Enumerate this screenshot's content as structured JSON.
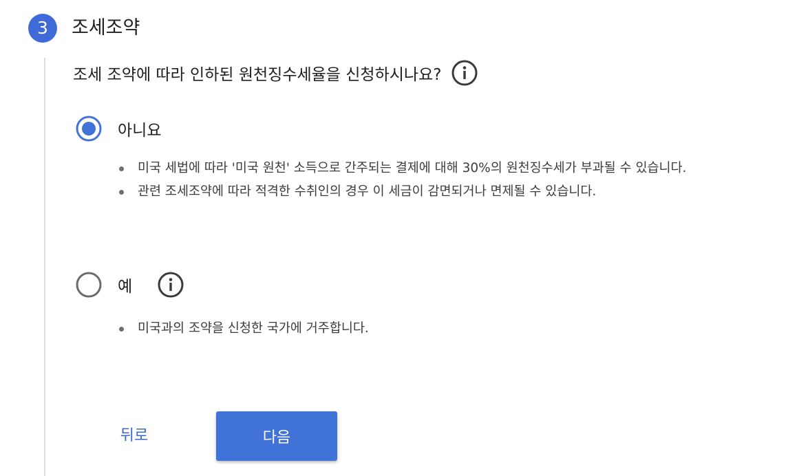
{
  "step": {
    "number": "3",
    "title": "조세조약"
  },
  "question": {
    "text": "조세 조약에 따라 인하된 원천징수세율을 신청하시나요?",
    "info_icon": "info-icon"
  },
  "options": [
    {
      "label": "아니요",
      "selected": true,
      "bullets": [
        "미국 세법에 따라 '미국 원천' 소득으로 간주되는 결제에 대해 30%의 원천징수세가 부과될 수 있습니다.",
        "관련 조세조약에 따라 적격한 수취인의 경우 이 세금이 감면되거나 면제될 수 있습니다."
      ]
    },
    {
      "label": "예",
      "selected": false,
      "info_icon": "info-icon",
      "bullets": [
        "미국과의 조약을 신청한 국가에 거주합니다."
      ]
    }
  ],
  "buttons": {
    "back_label": "뒤로",
    "next_label": "다음"
  },
  "colors": {
    "accent": "#4172d8",
    "step_badge": "#3f6ad8",
    "link": "#3b68c9",
    "radio_unselected": "#6b6b6b"
  }
}
